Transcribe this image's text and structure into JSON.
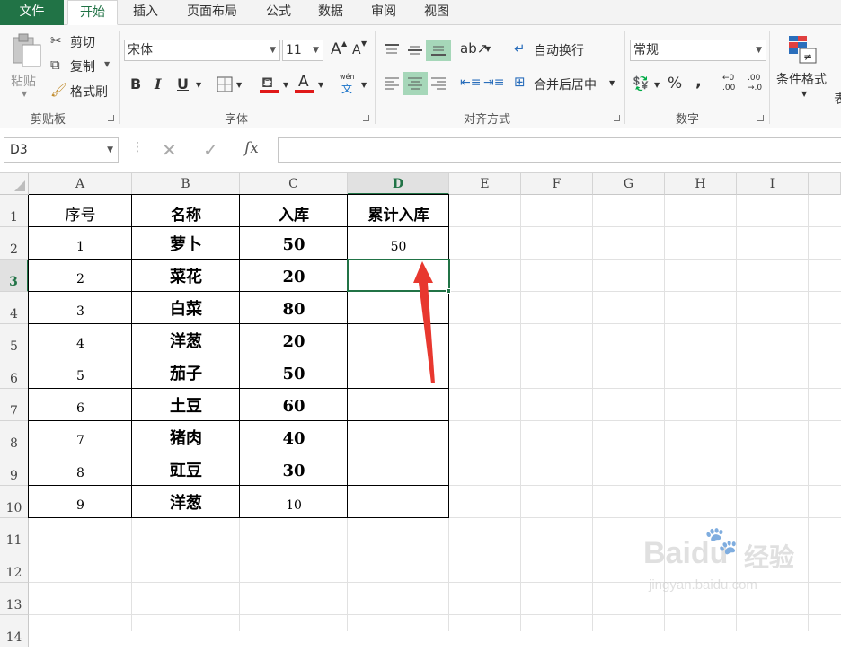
{
  "tabs": [
    {
      "label": "文件"
    },
    {
      "label": "开始"
    },
    {
      "label": "插入"
    },
    {
      "label": "页面布局"
    },
    {
      "label": "公式"
    },
    {
      "label": "数据"
    },
    {
      "label": "审阅"
    },
    {
      "label": "视图"
    }
  ],
  "ribbon": {
    "clipboard": {
      "paste": "粘贴",
      "cut": "剪切",
      "copy": "复制",
      "painter": "格式刷",
      "group": "剪贴板"
    },
    "font": {
      "name": "宋体",
      "size": "11",
      "group": "字体",
      "bold": "B",
      "italic": "I",
      "underline": "U",
      "grow": "A",
      "shrink": "A",
      "font_color": "A",
      "phonetic_top": "wén",
      "phonetic_bottom": "文"
    },
    "align": {
      "wrap": "自动换行",
      "merge": "合并后居中",
      "group": "对齐方式"
    },
    "number": {
      "format": "常规",
      "percent": "%",
      "comma": ",",
      "dec_inc_top": "←0",
      "dec_inc_bottom": ".00",
      "dec_dec_top": ".00",
      "dec_dec_bottom": "→.0",
      "group": "数字"
    },
    "styles": {
      "conditional": "条件格式",
      "cut_off": "表"
    }
  },
  "formula": {
    "namebox": "D3",
    "fx": "fx",
    "value": ""
  },
  "columns": [
    "A",
    "B",
    "C",
    "D",
    "E",
    "F",
    "G",
    "H",
    "I"
  ],
  "rows": [
    "1",
    "2",
    "3",
    "4",
    "5",
    "6",
    "7",
    "8",
    "9",
    "10",
    "11",
    "12",
    "13",
    "14"
  ],
  "table": {
    "headers": [
      "序号",
      "名称",
      "入库",
      "累计入库"
    ],
    "data": [
      [
        "1",
        "萝卜",
        "50",
        "50"
      ],
      [
        "2",
        "菜花",
        "20",
        ""
      ],
      [
        "3",
        "白菜",
        "80",
        ""
      ],
      [
        "4",
        "洋葱",
        "20",
        ""
      ],
      [
        "5",
        "茄子",
        "50",
        ""
      ],
      [
        "6",
        "土豆",
        "60",
        ""
      ],
      [
        "7",
        "猪肉",
        "40",
        ""
      ],
      [
        "8",
        "豇豆",
        "30",
        ""
      ],
      [
        "9",
        "洋葱",
        "10",
        ""
      ]
    ]
  },
  "watermark": {
    "brand": "Baidu",
    "brand_cn": "经验",
    "url": "jingyan.baidu.com"
  },
  "colors": {
    "accent": "#217346",
    "arrow": "#e8382f",
    "selection": "#217346"
  }
}
